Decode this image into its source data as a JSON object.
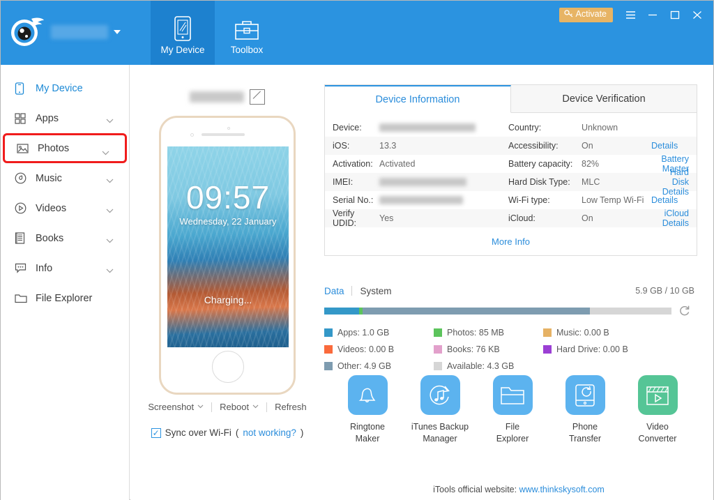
{
  "titlebar": {
    "account_name_redacted": "",
    "activate_label": "Activate",
    "activate_icon": "key-icon",
    "menu_icon": "hamburger-menu-icon",
    "minimize_icon": "minimize-icon",
    "maximize_icon": "maximize-icon",
    "close_icon": "close-icon",
    "accent": "#2b93e0",
    "activate_bg": "#e7b465",
    "tabs": [
      {
        "label": "My Device",
        "icon": "tablet-icon",
        "active": true
      },
      {
        "label": "Toolbox",
        "icon": "briefcase-icon",
        "active": false
      }
    ]
  },
  "sidebar": {
    "items": [
      {
        "label": "My Device",
        "icon": "phone-icon",
        "active": true,
        "chevron": false,
        "highlight": false
      },
      {
        "label": "Apps",
        "icon": "grid-apps-icon",
        "active": false,
        "chevron": true,
        "highlight": false
      },
      {
        "label": "Photos",
        "icon": "photo-icon",
        "active": false,
        "chevron": true,
        "highlight": true
      },
      {
        "label": "Music",
        "icon": "music-disc-icon",
        "active": false,
        "chevron": true,
        "highlight": false
      },
      {
        "label": "Videos",
        "icon": "video-play-icon",
        "active": false,
        "chevron": true,
        "highlight": false
      },
      {
        "label": "Books",
        "icon": "book-icon",
        "active": false,
        "chevron": true,
        "highlight": false
      },
      {
        "label": "Info",
        "icon": "info-bubble-icon",
        "active": false,
        "chevron": true,
        "highlight": false
      },
      {
        "label": "File Explorer",
        "icon": "folder-icon",
        "active": false,
        "chevron": false,
        "highlight": false
      }
    ],
    "highlight_color": "#f01c1c"
  },
  "device_panel": {
    "device_name_redacted": "",
    "rename_icon": "edit-pencil-icon",
    "lock_screen": {
      "time": "09:57",
      "date": "Wednesday, 22 January",
      "status": "Charging..."
    },
    "controls": [
      {
        "label": "Screenshot",
        "chevron": true
      },
      {
        "label": "Reboot",
        "chevron": true
      },
      {
        "label": "Refresh",
        "chevron": false
      }
    ],
    "sync": {
      "checked": true,
      "label": "Sync over Wi-Fi",
      "open_paren": "(",
      "link": "not working?",
      "close_paren": ")"
    }
  },
  "info_tabs": [
    {
      "label": "Device Information",
      "active": true
    },
    {
      "label": "Device Verification",
      "active": false
    }
  ],
  "info_rows": [
    {
      "label": "Device:",
      "value": "",
      "redacted": true,
      "label2": "Country:",
      "value2": "Unknown",
      "link2": ""
    },
    {
      "label": "iOS:",
      "value": "13.3",
      "redacted": false,
      "label2": "Accessibility:",
      "value2": "On",
      "link2": "Details"
    },
    {
      "label": "Activation:",
      "value": "Activated",
      "redacted": false,
      "label2": "Battery capacity:",
      "value2": "82%",
      "link2": "Battery Master"
    },
    {
      "label": "IMEI:",
      "value": "",
      "redacted": true,
      "label2": "Hard Disk Type:",
      "value2": "MLC",
      "link2": "Hard Disk Details"
    },
    {
      "label": "Serial No.:",
      "value": "",
      "redacted": true,
      "label2": "Wi-Fi type:",
      "value2": "Low Temp Wi-Fi",
      "link2": "Details"
    },
    {
      "label": "Verify UDID:",
      "value": "Yes",
      "redacted": false,
      "label2": "iCloud:",
      "value2": "On",
      "link2": "iCloud Details"
    }
  ],
  "more_info_label": "More Info",
  "storage": {
    "tabs": [
      {
        "label": "Data",
        "active": true
      },
      {
        "label": "System",
        "active": false
      }
    ],
    "capacity": "5.9 GB / 10 GB",
    "refresh_icon": "refresh-icon",
    "segments": [
      {
        "name": "Apps",
        "color": "#3498c8",
        "percent": 10.0
      },
      {
        "name": "Photos",
        "color": "#5cc45c",
        "percent": 0.9
      },
      {
        "name": "Other",
        "color": "#7e9cb0",
        "percent": 66.1
      },
      {
        "name": "Available",
        "color": "#d6d6d6",
        "percent": 23.0
      }
    ],
    "legend": [
      {
        "label": "Apps: 1.0 GB",
        "color": "#3498c8"
      },
      {
        "label": "Photos: 85 MB",
        "color": "#5cc45c"
      },
      {
        "label": "Music: 0.00 B",
        "color": "#e6b265"
      },
      {
        "label": "Videos: 0.00 B",
        "color": "#fa6a3c"
      },
      {
        "label": "Books: 76 KB",
        "color": "#e2a0cb"
      },
      {
        "label": "Hard Drive: 0.00 B",
        "color": "#9b3fd4"
      },
      {
        "label": "Other: 4.9 GB",
        "color": "#7e9cb0"
      },
      {
        "label": "Available: 4.3 GB",
        "color": "#d6d6d6"
      }
    ]
  },
  "tools": [
    {
      "label": "Ringtone\nMaker",
      "icon": "bell-icon",
      "bg": "#5cb3ef"
    },
    {
      "label": "iTunes Backup\nManager",
      "icon": "music-refresh-icon",
      "bg": "#5cb3ef"
    },
    {
      "label": "File\nExplorer",
      "icon": "folder-icon",
      "bg": "#5cb3ef"
    },
    {
      "label": "Phone\nTransfer",
      "icon": "phone-transfer-icon",
      "bg": "#5cb3ef"
    },
    {
      "label": "Video\nConverter",
      "icon": "film-play-icon",
      "bg": "#55c596"
    }
  ],
  "footer": {
    "text": "iTools official website:",
    "link": "www.thinkskysoft.com"
  }
}
